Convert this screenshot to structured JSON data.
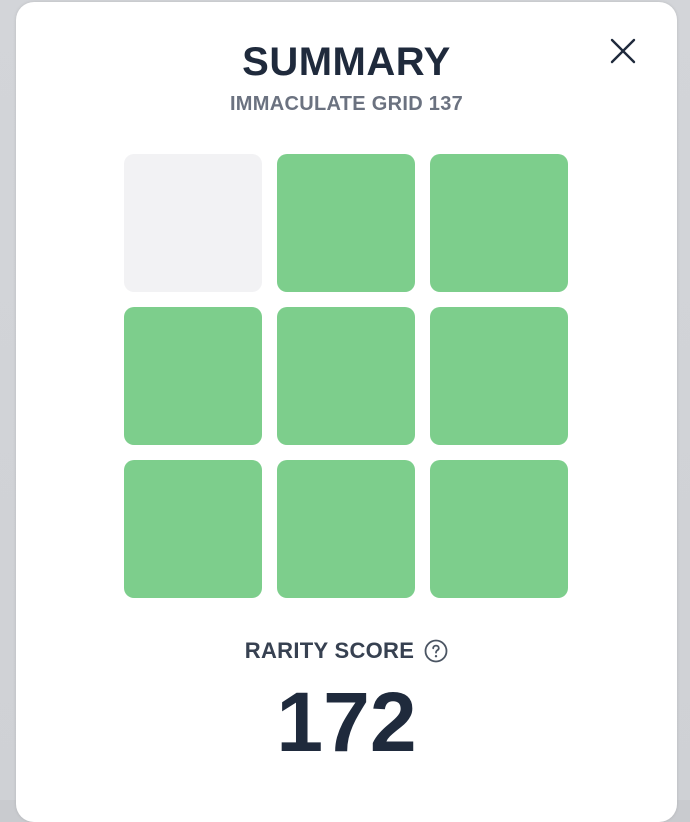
{
  "summary": {
    "title": "SUMMARY",
    "subtitle": "IMMACULATE GRID 137"
  },
  "grid": {
    "cells": [
      {
        "status": "empty"
      },
      {
        "status": "filled"
      },
      {
        "status": "filled"
      },
      {
        "status": "filled"
      },
      {
        "status": "filled"
      },
      {
        "status": "filled"
      },
      {
        "status": "filled"
      },
      {
        "status": "filled"
      },
      {
        "status": "filled"
      }
    ]
  },
  "rarity": {
    "label": "RARITY SCORE",
    "score": "172"
  },
  "icons": {
    "close": "close-icon",
    "help": "question-circle-icon"
  },
  "colors": {
    "correct": "#7dce8c",
    "empty": "#f2f2f4",
    "title": "#1f2a3c",
    "subtitle": "#6b7280"
  }
}
